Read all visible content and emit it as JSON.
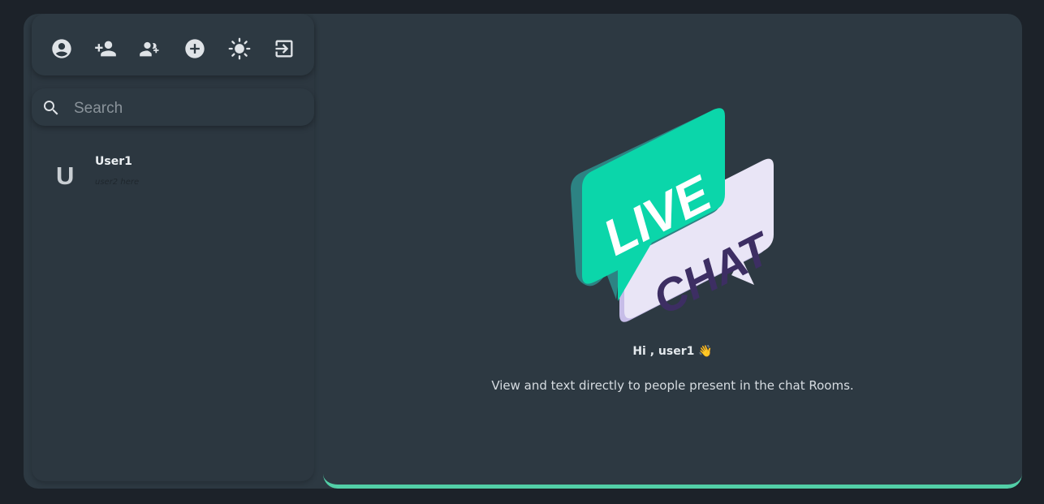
{
  "toolbar": {
    "buttons": [
      {
        "icon": "account-circle-icon"
      },
      {
        "icon": "person-add-icon"
      },
      {
        "icon": "group-add-icon"
      },
      {
        "icon": "add-circle-icon"
      },
      {
        "icon": "brightness-icon"
      },
      {
        "icon": "logout-icon"
      }
    ]
  },
  "search": {
    "placeholder": "Search",
    "value": ""
  },
  "chats": [
    {
      "initial": "U",
      "name": "User1",
      "preview": "user2 here"
    }
  ],
  "welcome": {
    "logo_text_top": "LIVE",
    "logo_text_bottom": "CHAT",
    "greeting": "Hi , user1 👋",
    "tagline": "View and text directly to people present in the chat Rooms."
  },
  "colors": {
    "page_bg": "#1c2229",
    "panel_bg": "#2d3942",
    "accent": "#52cfa7",
    "logo_green": "#0bd6aa",
    "logo_lavender": "#e9e5f6",
    "logo_purple_text": "#3d2e63"
  }
}
